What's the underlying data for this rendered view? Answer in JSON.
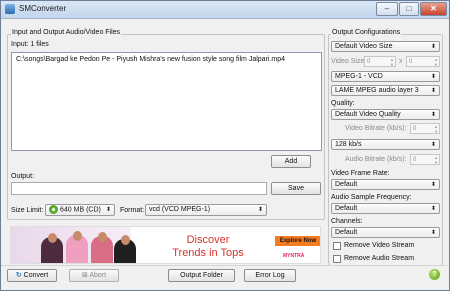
{
  "window": {
    "title": "SMConverter"
  },
  "input_group": {
    "title": "Input and Output Audio/Video Files",
    "count_label": "Input: 1 files",
    "files": [
      "C:\\songs\\Bargad ke Pedon Pe - Piyush Mishra's new fusion style song film Jalpari.mp4"
    ],
    "add_label": "Add",
    "output_label": "Output:",
    "output_value": "",
    "save_label": "Save",
    "size_limit_label": "Size Limit:",
    "size_limit_value": "640 MB (CD)",
    "format_label": "Format:",
    "format_value": "vcd (VCD MPEG-1)"
  },
  "ad": {
    "headline_1": "Discover",
    "headline_2": "Trends in Tops",
    "cta": "Explore Now",
    "brand": "MYNTRA"
  },
  "output_config": {
    "title": "Output Configurations",
    "video_size_select": "Default Video Size",
    "video_size_label": "Video Size:",
    "video_w": "0",
    "video_x": "x",
    "video_h": "0",
    "video_codec": "MPEG-1 - VCD",
    "audio_codec": "LAME MPEG audio layer 3",
    "quality_label": "Quality:",
    "quality_select": "Default Video Quality",
    "video_bitrate_label": "Video Bitrate (kb/s):",
    "video_bitrate_value": "0",
    "audio_bitrate_select": "128 kb/s",
    "audio_bitrate_label": "Audio Bitrate (kb/s):",
    "audio_bitrate_value": "0",
    "frame_rate_label": "Video Frame Rate:",
    "frame_rate_select": "Default",
    "sample_freq_label": "Audio Sample Frequency:",
    "sample_freq_select": "Default",
    "channels_label": "Channels:",
    "channels_select": "Default",
    "remove_video_label": "Remove Video Stream",
    "remove_audio_label": "Remove Audio Stream"
  },
  "footer": {
    "convert_label": "Convert",
    "abort_label": "Abort",
    "output_folder_label": "Output Folder",
    "error_log_label": "Error Log"
  },
  "icons": [
    "app-icon",
    "minimize-icon",
    "maximize-icon",
    "close-icon",
    "convert-icon",
    "abort-icon",
    "cd-icon",
    "help-icon",
    "dropdown-arrow-icon",
    "spin-arrows-icon"
  ]
}
